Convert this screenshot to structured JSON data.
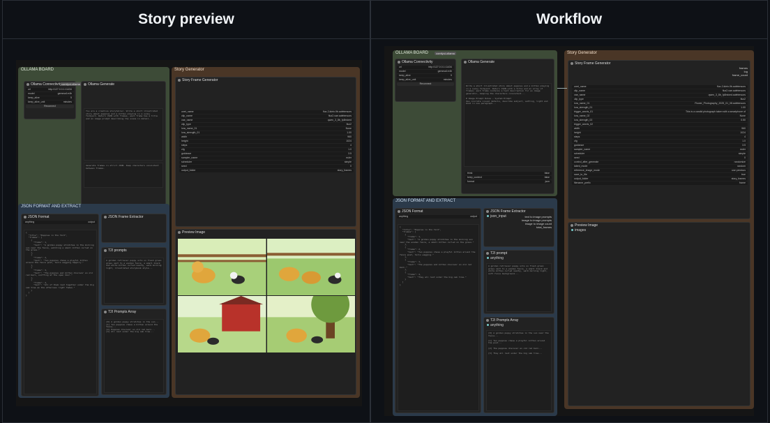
{
  "headers": {
    "left": "Story preview",
    "right": "Workflow"
  },
  "colors": {
    "ollama_node": "#3d4b37",
    "json_node": "#2b3a4a",
    "story_node": "#4a3626",
    "canvas": "#151515"
  },
  "left": {
    "ollama_board": {
      "title": "OLLAMA BOARD",
      "badge": "comfyui-ollama",
      "connectivity": "Ollama Connectivity",
      "generate": "Ollama Generate",
      "url": "http://127.0.0.1:11434",
      "model": "gemma4:e4b",
      "keep_alive": "5",
      "keep_alive_unit": "minutes",
      "reconnect": "Reconnect"
    },
    "json_board": {
      "title": "JSON FORMAT AND EXTRACT",
      "badge": "comfyui-easy-use",
      "json_format": "JSON Format",
      "frame_extractor": "JSON Frame Extractor",
      "t2i": "T2I prompts",
      "array": "T2I Prompts Array",
      "anything": "anything"
    },
    "story": {
      "title": "Story Generator",
      "frame_gen": "Story Frame Generator",
      "preview": "Preview Image"
    }
  },
  "right": {
    "ollama_board": {
      "title": "OLLAMA BOARD",
      "badge": "comfyui-ollama",
      "connectivity": "Ollama Connectivity",
      "generate": "Ollama Generate",
      "url": "http://127.0.0.1:11434",
      "model": "gemma4:e4b",
      "keep_alive": "5",
      "keep_alive_unit": "minutes",
      "reconnect": "Reconnect",
      "think": "think",
      "keep_context": "keep_context",
      "format": "format",
      "think_val": "false",
      "keep_val": "false",
      "format_val": "json"
    },
    "json_board": {
      "title": "JSON FORMAT AND EXTRACT",
      "badge": "comfyui-easy-use",
      "json_format": "JSON Format",
      "frame_extractor": "JSON Frame Extractor",
      "t2i": "T2I prompt",
      "array": "T2I Prompts Array",
      "anything": "anything",
      "json_input": "json_input",
      "outputs": [
        "text to image prompts",
        "image to image prompts",
        "image to image count",
        "total_frames"
      ]
    },
    "story": {
      "title": "Story Generator",
      "frame_gen": "Story Frame Generator",
      "preview": "Preview Image",
      "images": "images",
      "outputs": [
        "frames",
        "log",
        "frame_count"
      ],
      "fields": [
        [
          "unet_name",
          "flux-2-klein-9b.safetensors"
        ],
        [
          "clip_name",
          "flux2-vae.safetensors"
        ],
        [
          "vae_name",
          "qwen_3_8b_fp8mixed.safetensors"
        ],
        [
          "clip_type",
          "flux2"
        ],
        [
          "lora_name_01",
          "Flower_Photography_2025_01_08.safetensors"
        ],
        [
          "lora_strength_01",
          "1.00"
        ],
        [
          "trigger_words_01",
          "This is a candid photograph taken with a smartphone of"
        ],
        [
          "lora_name_02",
          "None"
        ],
        [
          "lora_strength_02",
          "0.50"
        ],
        [
          "trigger_words_02",
          ""
        ],
        [
          "width",
          "960"
        ],
        [
          "height",
          "1024"
        ],
        [
          "steps",
          "4"
        ],
        [
          "cfg",
          "1.0"
        ],
        [
          "guidance",
          "3.5"
        ],
        [
          "sampler_name",
          "euler"
        ],
        [
          "scheduler",
          "simple"
        ],
        [
          "seed",
          "0"
        ],
        [
          "control_after_generate",
          "randomize"
        ],
        [
          "latent_mode",
          "random"
        ],
        [
          "reference_image_mode",
          "use previous"
        ],
        [
          "save_to_file",
          "true"
        ],
        [
          "output_folder",
          "story_frames"
        ],
        [
          "filename_prefix",
          "frame"
        ]
      ]
    }
  },
  "icons": {
    "node_dot": "circle-dot-icon",
    "collapse": "triangle-icon"
  }
}
